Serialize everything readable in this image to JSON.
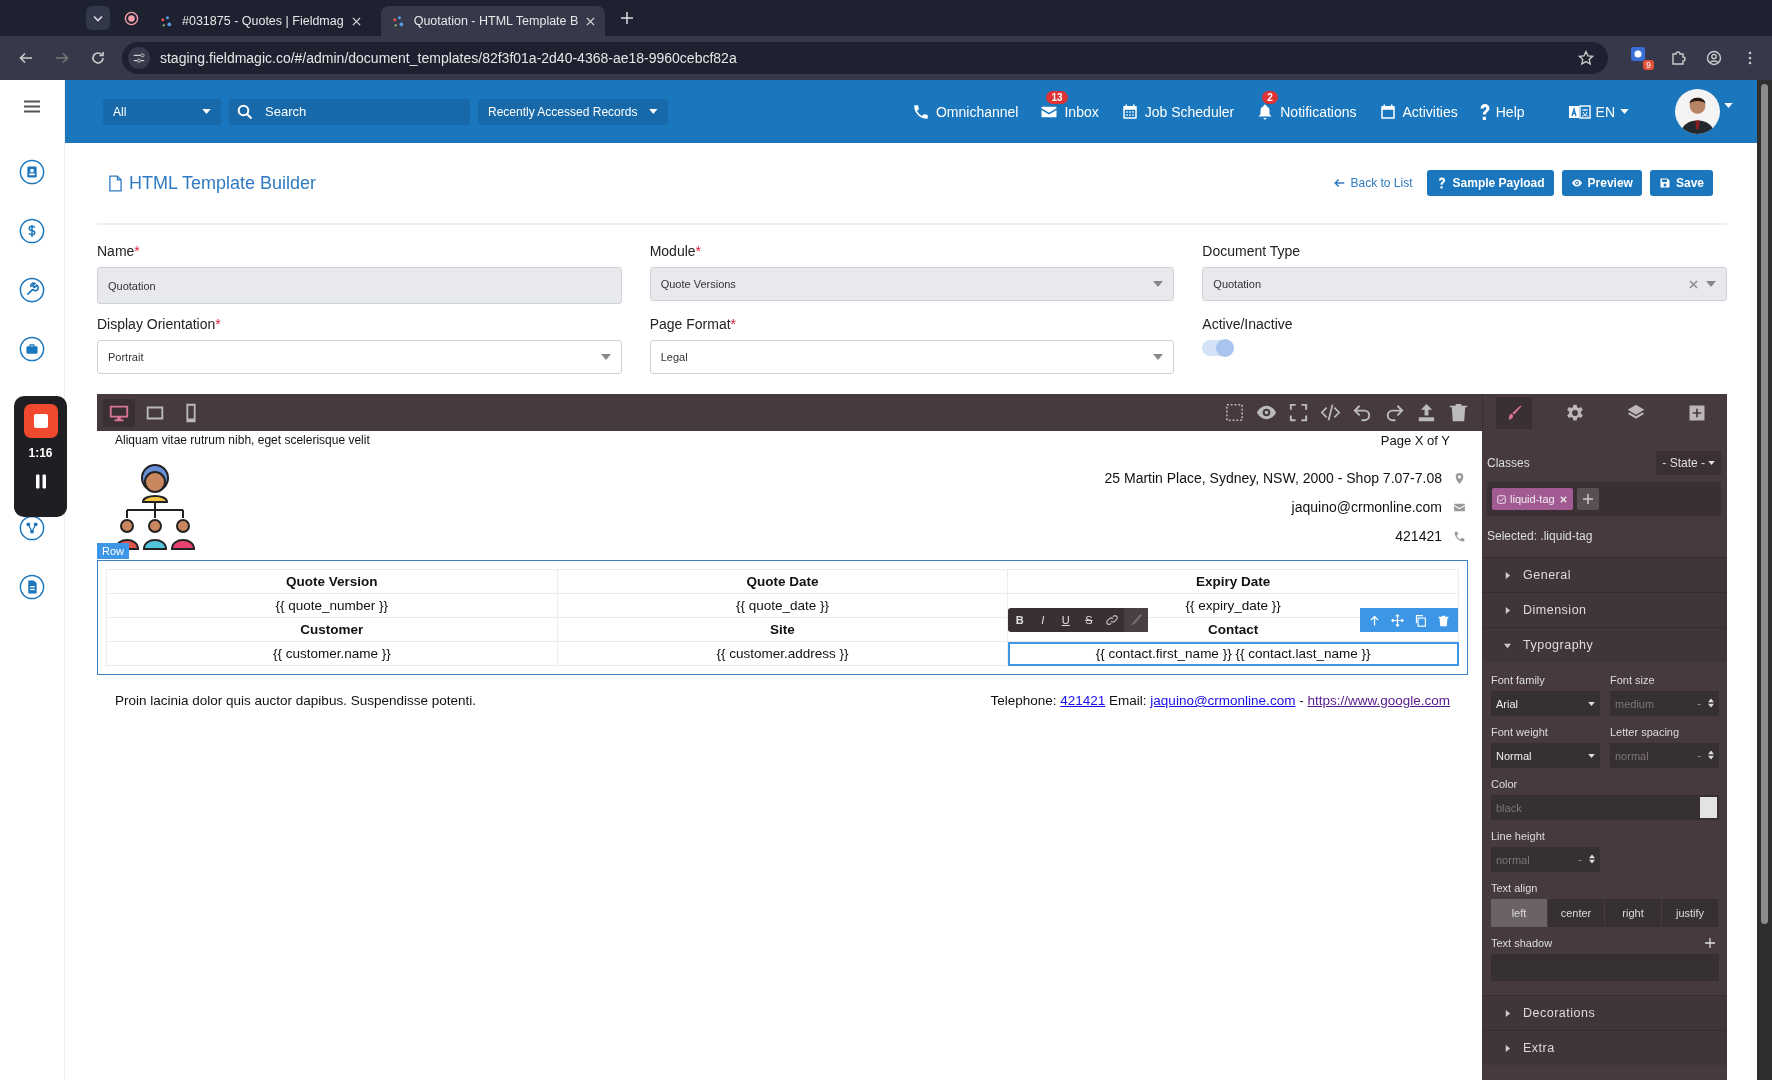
{
  "browser": {
    "tabs": [
      {
        "title": "#031875 - Quotes | Fieldmag",
        "selected": false
      },
      {
        "title": "Quotation - HTML Template B",
        "selected": true
      }
    ],
    "url": "staging.fieldmagic.co/#/admin/document_templates/82f3f01a-2d40-4368-ae18-9960cebcf82a",
    "extension_badge": "9"
  },
  "recorder": {
    "time": "1:16"
  },
  "topbar": {
    "scope": "All",
    "search_placeholder": "Search",
    "recent": "Recently Accessed Records",
    "language": "EN",
    "nav": [
      {
        "kind": "phone",
        "label": "Omnichannel"
      },
      {
        "kind": "mail",
        "label": "Inbox",
        "badge": "13"
      },
      {
        "kind": "calendar",
        "label": "Job Scheduler"
      },
      {
        "kind": "bell",
        "label": "Notifications",
        "badge": "2"
      },
      {
        "kind": "agenda",
        "label": "Activities"
      },
      {
        "kind": "help",
        "label": "Help"
      }
    ]
  },
  "page": {
    "title": "HTML Template Builder",
    "back": "Back to List",
    "buttons": [
      {
        "kind": "help",
        "label": "Sample Payload"
      },
      {
        "kind": "eye",
        "label": "Preview"
      },
      {
        "kind": "save",
        "label": "Save"
      }
    ]
  },
  "required_mark": "*",
  "fields": [
    {
      "kind": "input",
      "label": "Name",
      "required": true,
      "value": "Quotation",
      "disabled": true
    },
    {
      "kind": "select",
      "label": "Module",
      "required": true,
      "value": "Quote Versions",
      "disabled": true
    },
    {
      "kind": "select",
      "label": "Document Type",
      "required": false,
      "value": "Quotation",
      "disabled": true,
      "clearable": true
    },
    {
      "kind": "select",
      "label": "Display Orientation",
      "required": true,
      "value": "Portrait",
      "disabled": false
    },
    {
      "kind": "select",
      "label": "Page Format",
      "required": true,
      "value": "Legal",
      "disabled": false
    },
    {
      "kind": "toggle",
      "label": "Active/Inactive",
      "required": false,
      "on": true
    }
  ],
  "editor": {
    "devices": [
      {
        "kind": "desktop",
        "selected": true
      },
      {
        "kind": "tablet",
        "selected": false
      },
      {
        "kind": "mobile",
        "selected": false
      }
    ],
    "panels": [
      {
        "kind": "brush",
        "selected": true
      },
      {
        "kind": "gear",
        "selected": false
      },
      {
        "kind": "layers",
        "selected": false
      },
      {
        "kind": "blocks",
        "selected": false
      }
    ]
  },
  "canvas": {
    "header_left": "Aliquam vitae rutrum nibh, eget scelerisque velit",
    "header_right": "Page X of Y",
    "contacts": [
      {
        "kind": "pin",
        "text": "25 Martin Place, Sydney, NSW, 2000 - Shop 7.07-7.08"
      },
      {
        "kind": "mail",
        "text": "jaquino@crmonline.com"
      },
      {
        "kind": "phone",
        "text": "421421"
      }
    ],
    "row_badge": "Row",
    "rte_buttons": [
      "B",
      "I",
      "U",
      "S"
    ],
    "table": [
      {
        "header": true,
        "cells": [
          {
            "text": "Quote Version",
            "selected": false
          },
          {
            "text": "Quote Date",
            "selected": false
          },
          {
            "text": "Expiry Date",
            "selected": false
          }
        ]
      },
      {
        "header": false,
        "cells": [
          {
            "text": "{{ quote_number }}",
            "selected": false
          },
          {
            "text": "{{ quote_date }}",
            "selected": false
          },
          {
            "text": "{{ expiry_date }}",
            "selected": false
          }
        ]
      },
      {
        "header": true,
        "cells": [
          {
            "text": "Customer",
            "selected": false
          },
          {
            "text": "Site",
            "selected": false
          },
          {
            "text": "Contact",
            "selected": false
          }
        ]
      },
      {
        "header": false,
        "cells": [
          {
            "text": "{{ customer.name }}",
            "selected": false
          },
          {
            "text": "{{ customer.address }}",
            "selected": false
          },
          {
            "text": "{{ contact.first_name }} {{ contact.last_name }}",
            "selected": true
          }
        ]
      }
    ],
    "footer_left": "Proin lacinia dolor quis auctor dapibus. Suspendisse potenti.",
    "footer_right": [
      {
        "text": "Telephone:",
        "link": false
      },
      {
        "text": "421421",
        "link": true,
        "visited": false
      },
      {
        "text": "Email:",
        "link": false
      },
      {
        "text": "jaquino@crmonline.com",
        "link": true,
        "visited": false
      },
      {
        "text": "-",
        "link": false
      },
      {
        "text": "https://www.google.com",
        "link": true,
        "visited": true
      }
    ]
  },
  "style_panel": {
    "classes_label": "Classes",
    "state": "- State -",
    "tag": "liquid-tag",
    "selected_label": "Selected:",
    "selected_value": ".liquid-tag",
    "sections": [
      {
        "title": "General",
        "expanded": false
      },
      {
        "title": "Dimension",
        "expanded": false
      },
      {
        "title": "Typography",
        "expanded": true,
        "properties": [
          {
            "kind": "select",
            "label": "Font family",
            "value": "Arial"
          },
          {
            "kind": "number",
            "label": "Font size",
            "placeholder": "medium",
            "unit": "-"
          },
          {
            "kind": "select",
            "label": "Font weight",
            "value": "Normal"
          },
          {
            "kind": "number",
            "label": "Letter spacing",
            "placeholder": "normal",
            "unit": "-"
          },
          {
            "kind": "color",
            "label": "Color",
            "placeholder": "black"
          },
          {
            "kind": "number",
            "label": "Line height",
            "placeholder": "normal",
            "unit": "-"
          },
          {
            "kind": "radio",
            "label": "Text align",
            "options": [
              {
                "label": "left",
                "selected": true
              },
              {
                "label": "center",
                "selected": false
              },
              {
                "label": "right",
                "selected": false
              },
              {
                "label": "justify",
                "selected": false
              }
            ]
          },
          {
            "kind": "stack",
            "label": "Text shadow"
          }
        ]
      },
      {
        "title": "Decorations",
        "expanded": false
      },
      {
        "title": "Extra",
        "expanded": false
      }
    ]
  }
}
